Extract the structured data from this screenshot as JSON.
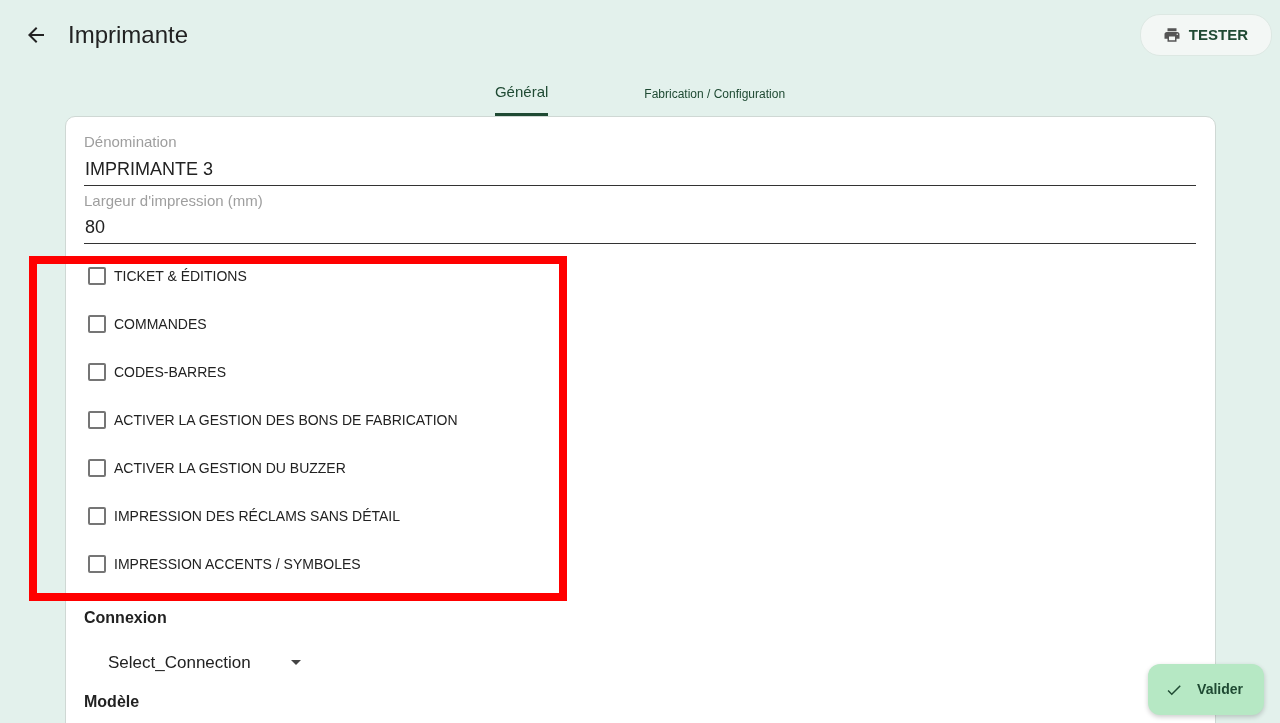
{
  "header": {
    "title": "Imprimante",
    "test_button": "TESTER"
  },
  "tabs": [
    {
      "label": "Général",
      "selected": true
    },
    {
      "label": "Fabrication / Configuration",
      "selected": false
    }
  ],
  "fields": [
    {
      "label": "Dénomination",
      "value": "IMPRIMANTE 3"
    },
    {
      "label": "Largeur d'impression (mm)",
      "value": "80"
    }
  ],
  "options": [
    {
      "label": "TICKET & ÉDITIONS",
      "checked": false
    },
    {
      "label": "COMMANDES",
      "checked": false
    },
    {
      "label": "CODES-BARRES",
      "checked": false
    },
    {
      "label": "ACTIVER LA GESTION DES BONS DE FABRICATION",
      "checked": false
    },
    {
      "label": "ACTIVER LA GESTION DU BUZZER",
      "checked": false
    },
    {
      "label": "IMPRESSION DES RÉCLAMS SANS DÉTAIL",
      "checked": false
    },
    {
      "label": "IMPRESSION ACCENTS / SYMBOLES",
      "checked": false
    }
  ],
  "connection": {
    "heading": "Connexion",
    "select_value": "Select_Connection"
  },
  "model": {
    "heading": "Modèle"
  },
  "submit_button": "Valider"
}
